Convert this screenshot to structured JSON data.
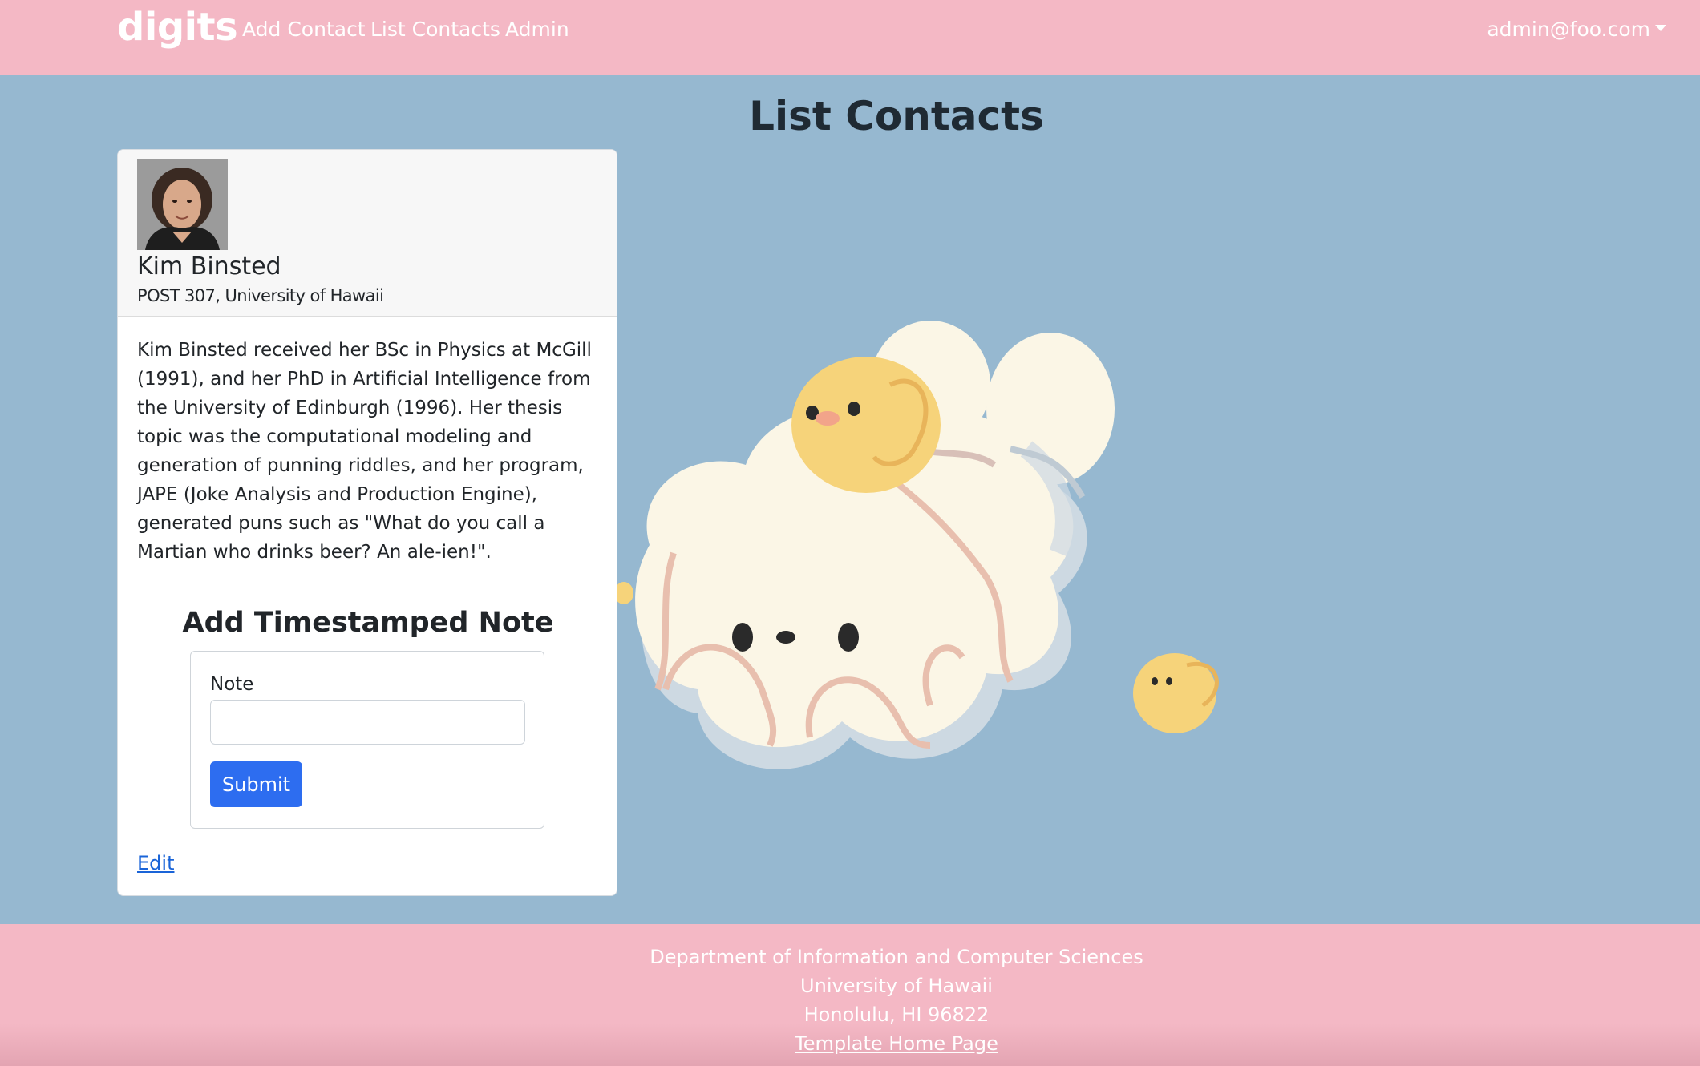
{
  "navbar": {
    "brand": "digits",
    "links": [
      "Add Contact",
      "List Contacts",
      "Admin"
    ],
    "user": "admin@foo.com"
  },
  "page": {
    "title": "List Contacts"
  },
  "contact": {
    "name": "Kim Binsted",
    "address": "POST 307, University of Hawaii",
    "description": "Kim Binsted received her BSc in Physics at McGill (1991), and her PhD in Artificial Intelligence from the University of Edinburgh (1996). Her thesis topic was the computational modeling and generation of punning riddles, and her program, JAPE (Joke Analysis and Production Engine), generated puns such as \"What do you call a Martian who drinks beer? An ale-ien!\".",
    "edit_label": "Edit"
  },
  "note_form": {
    "heading": "Add Timestamped Note",
    "label": "Note",
    "value": "",
    "submit_label": "Submit"
  },
  "footer": {
    "line1": "Department of Information and Computer Sciences",
    "line2": "University of Hawaii",
    "line3": "Honolulu, HI 96822",
    "link": "Template Home Page"
  },
  "colors": {
    "navbar_bg": "#f4b8c5",
    "page_bg": "#96b8d0",
    "button_primary": "#2d6df0",
    "link": "#1a64d8"
  }
}
